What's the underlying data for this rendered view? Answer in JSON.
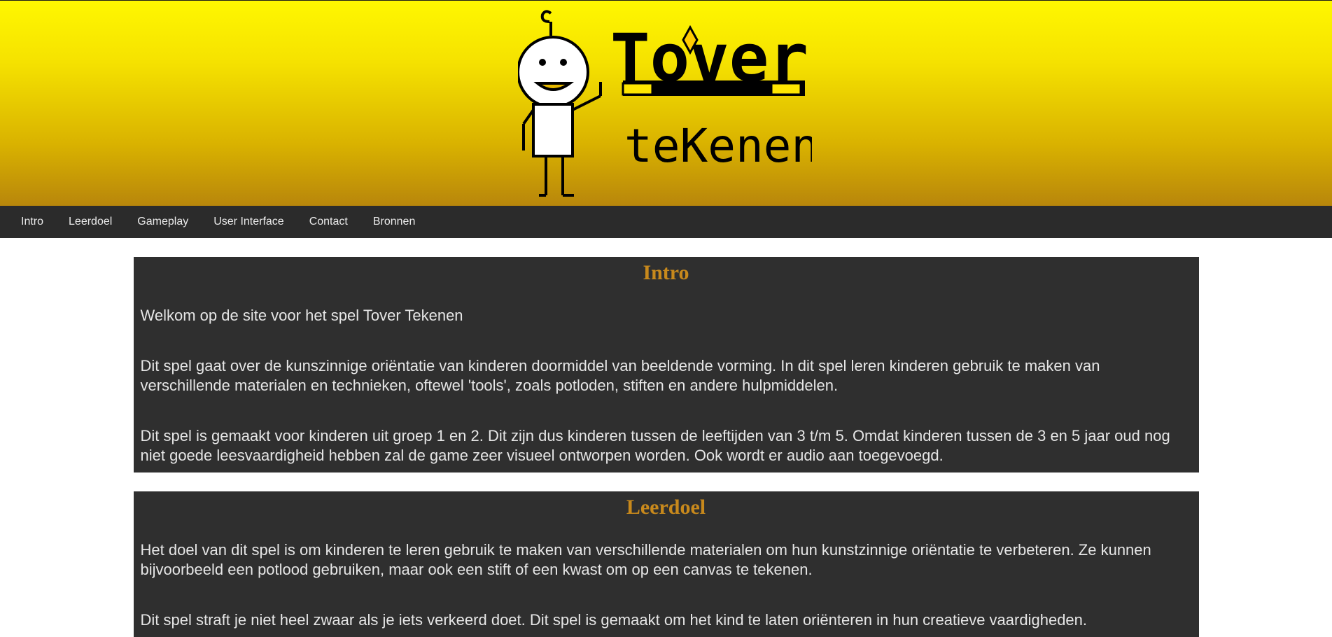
{
  "header": {
    "logo_text_top": "Tover",
    "logo_text_bottom": "teKenen",
    "colors": {
      "gradient_top": "#fff700",
      "gradient_bottom": "#b8860b"
    }
  },
  "nav": {
    "items": [
      {
        "label": "Intro"
      },
      {
        "label": "Leerdoel"
      },
      {
        "label": "Gameplay"
      },
      {
        "label": "User Interface"
      },
      {
        "label": "Contact"
      },
      {
        "label": "Bronnen"
      }
    ]
  },
  "sections": [
    {
      "title": "Intro",
      "paragraphs": [
        "Welkom op de site voor het spel Tover Tekenen",
        "Dit spel gaat over de kunszinnige oriëntatie van kinderen doormiddel van beeldende vorming. In dit spel leren kinderen gebruik te maken van verschillende materialen en technieken, oftewel 'tools', zoals potloden, stiften en andere hulpmiddelen.",
        "Dit spel is gemaakt voor kinderen uit groep 1 en 2. Dit zijn dus kinderen tussen de leeftijden van 3 t/m 5. Omdat kinderen tussen de 3 en 5 jaar oud nog niet goede leesvaardigheid hebben zal de game zeer visueel ontworpen worden. Ook wordt er audio aan toegevoegd."
      ]
    },
    {
      "title": "Leerdoel",
      "paragraphs": [
        "Het doel van dit spel is om kinderen te leren gebruik te maken van verschillende materialen om hun kunstzinnige oriëntatie te verbeteren. Ze kunnen bijvoorbeeld een potlood gebruiken, maar ook een stift of een kwast om op een canvas te tekenen.",
        "Dit spel straft je niet heel zwaar als je iets verkeerd doet. Dit spel is gemaakt om het kind te laten oriënteren in hun creatieve vaardigheden."
      ]
    }
  ],
  "theme": {
    "accent": "#c8891c",
    "panel": "#2f2f2f",
    "nav": "#2b2b2b"
  }
}
